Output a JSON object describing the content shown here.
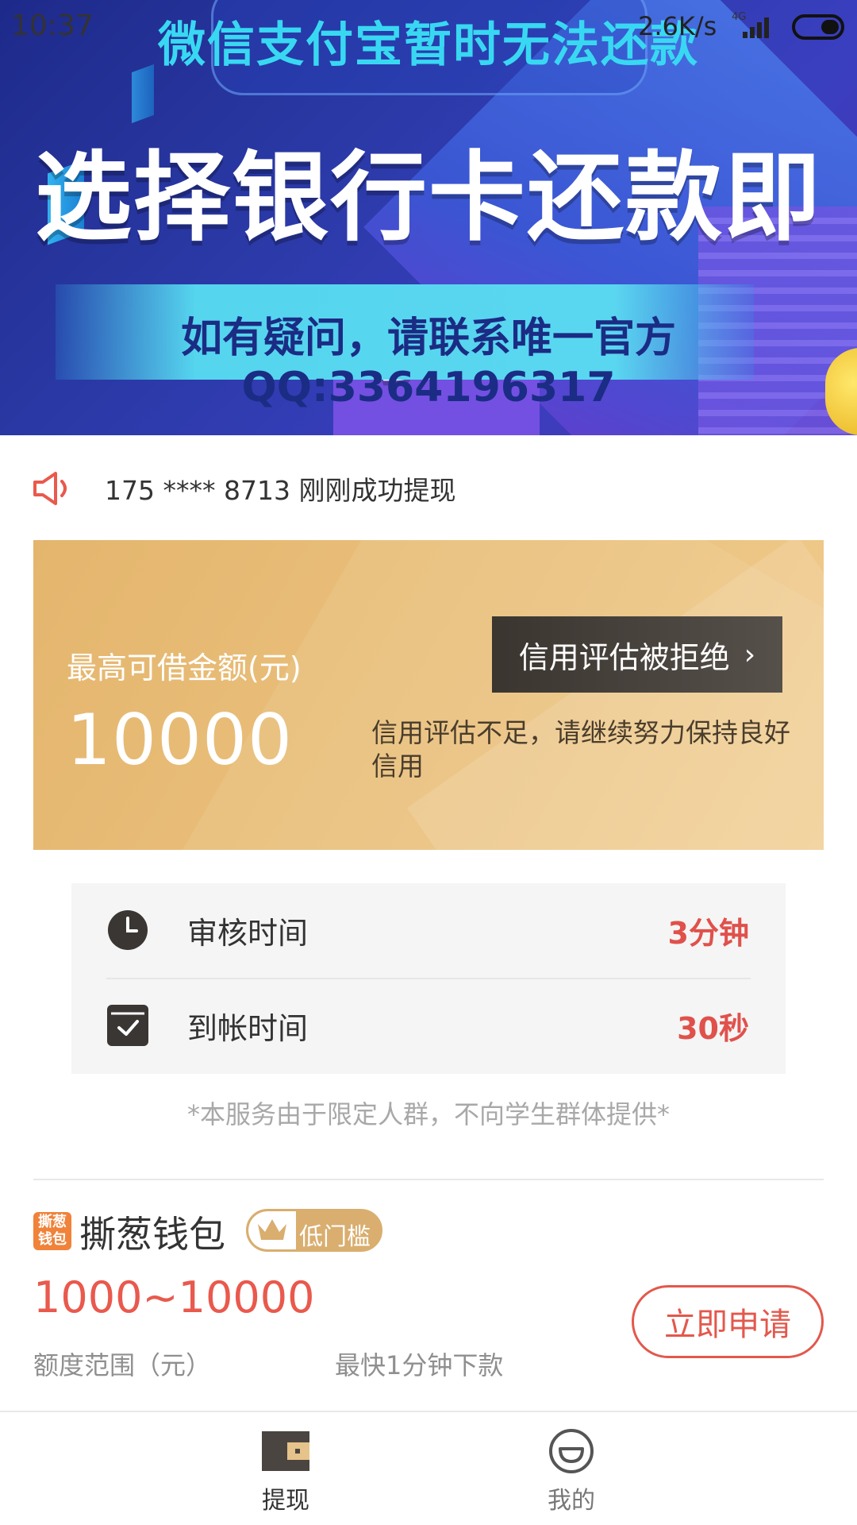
{
  "status_bar": {
    "time": "10:37",
    "network_speed": "2.6K/s",
    "network_type": "4G"
  },
  "banner": {
    "line1": "微信支付宝暂时无法还款",
    "line2": "选择银行卡还款即可！",
    "line3": "如有疑问，请联系唯一官方QQ:3364196317"
  },
  "notice": {
    "text": "175 **** 8713 刚刚成功提现"
  },
  "credit": {
    "label": "最高可借金额(元)",
    "amount": "10000",
    "reject_button": "信用评估被拒绝",
    "note": "信用评估不足，请继续努力保持良好信用"
  },
  "info": {
    "review_label": "审核时间",
    "review_value": "3分钟",
    "arrival_label": "到帐时间",
    "arrival_value": "30秒"
  },
  "disclaimer": "*本服务由于限定人群，不向学生群体提供*",
  "product": {
    "logo_text": "撕葱钱包",
    "name": "撕葱钱包",
    "badge": "低门槛",
    "range": "1000~10000",
    "range_label": "额度范围（元）",
    "speed": "最快1分钟下款",
    "apply_button": "立即申请"
  },
  "nav": {
    "withdraw": "提现",
    "mine": "我的"
  },
  "colors": {
    "accent_red": "#e0514b",
    "gold": "#e4b56d",
    "banner_blue": "#2b3aa8"
  }
}
